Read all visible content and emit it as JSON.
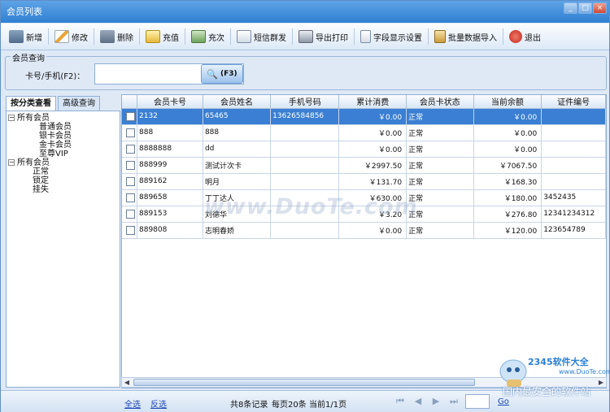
{
  "window": {
    "title": "会员列表",
    "controls": [
      "_",
      "□",
      "×"
    ]
  },
  "toolbar": {
    "new": "新增",
    "edit": "修改",
    "delete": "删除",
    "recharge": "充值",
    "recharge_times": "充次",
    "sms": "短信群发",
    "print": "导出打印",
    "fields": "字段显示设置",
    "import": "批量数据导入",
    "exit": "退出"
  },
  "query": {
    "group_title": "会员查询",
    "label": "卡号/手机(F2)：",
    "value": "",
    "button_label": "(F3)"
  },
  "tabs": [
    "按分类查看",
    "高级查询"
  ],
  "tree": {
    "group1": {
      "label": "所有会员",
      "children": [
        "普通会员",
        "银卡会员",
        "金卡会员",
        "至尊VIP"
      ]
    },
    "group2": {
      "label": "所有会员",
      "children": [
        "正常",
        "锁定",
        "挂失"
      ]
    }
  },
  "table": {
    "columns": [
      "会员卡号",
      "会员姓名",
      "手机号码",
      "累计消费",
      "会员卡状态",
      "当前余额",
      "证件编号"
    ],
    "rows": [
      {
        "card": "2132",
        "name": "65465",
        "phone": "13626584856",
        "spent": "￥0.00",
        "status": "正常",
        "balance": "￥0.00",
        "id": "",
        "selected": true
      },
      {
        "card": "888",
        "name": "888",
        "phone": "",
        "spent": "￥0.00",
        "status": "正常",
        "balance": "￥0.00",
        "id": ""
      },
      {
        "card": "8888888",
        "name": "dd",
        "phone": "",
        "spent": "￥0.00",
        "status": "正常",
        "balance": "￥0.00",
        "id": ""
      },
      {
        "card": "888999",
        "name": "测试计次卡",
        "phone": "",
        "spent": "￥2997.50",
        "status": "正常",
        "balance": "￥7067.50",
        "id": ""
      },
      {
        "card": "889162",
        "name": "明月",
        "phone": "",
        "spent": "￥131.70",
        "status": "正常",
        "balance": "￥168.30",
        "id": ""
      },
      {
        "card": "889658",
        "name": "丁丁达人",
        "phone": "",
        "spent": "￥630.00",
        "status": "正常",
        "balance": "￥180.00",
        "id": "3452435"
      },
      {
        "card": "889153",
        "name": "刘德华",
        "phone": "",
        "spent": "￥3.20",
        "status": "正常",
        "balance": "￥276.80",
        "id": "12341234312"
      },
      {
        "card": "889808",
        "name": "志明春娇",
        "phone": "",
        "spent": "￥0.00",
        "status": "正常",
        "balance": "￥120.00",
        "id": "123654789"
      }
    ]
  },
  "footer": {
    "select_all": "全选",
    "invert": "反选",
    "records": "共8条记录",
    "per_page": "每页20条",
    "current": "当前1/1页",
    "go": "Go",
    "page_value": ""
  },
  "watermark": {
    "text": "www.DuoTe.com"
  },
  "branding": {
    "name": "2345软件大全",
    "url": "www.DuoTe.com",
    "slogan": "国内最安全的软件站"
  },
  "colors": {
    "selection": "#3a7fd3",
    "titlebar": "#2f7fd2",
    "link": "#1a46b8"
  }
}
